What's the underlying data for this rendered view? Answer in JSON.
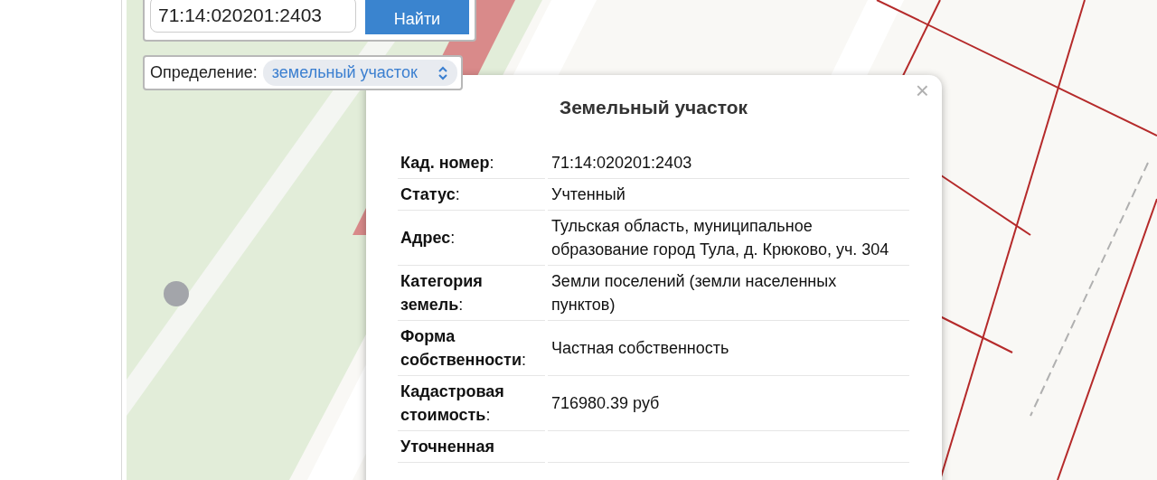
{
  "search": {
    "value": "71:14:020201:2403",
    "button": "Найти"
  },
  "definition": {
    "label": "Определение:",
    "value": "земельный участок"
  },
  "popup": {
    "title": "Земельный участок",
    "close": "×",
    "rows": [
      {
        "label": "**Кад. номер**:",
        "value": "71:14:020201:2403"
      },
      {
        "label": "**Статус**:",
        "value": "Учтенный"
      },
      {
        "label": "**Адрес**:",
        "value": "Тульская область, муниципальное образование город Тула, д. Крюково, уч. 304"
      },
      {
        "label": "**Категория земель**:",
        "value": "Земли поселений (земли населенных пунктов)"
      },
      {
        "label": "**Форма собственности**:",
        "value": "Частная собственность"
      },
      {
        "label": "**Кадастровая стоимость**:",
        "value": "716980.39 руб"
      },
      {
        "label": "**Уточненная**"
      }
    ]
  }
}
